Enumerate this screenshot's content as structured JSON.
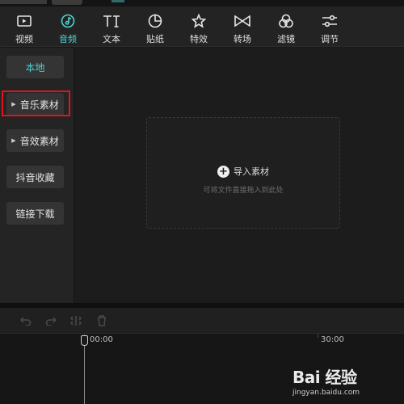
{
  "toolbar": {
    "items": [
      {
        "label": "视频",
        "icon": "video-icon"
      },
      {
        "label": "音频",
        "icon": "music-note-icon"
      },
      {
        "label": "文本",
        "icon": "text-icon"
      },
      {
        "label": "贴纸",
        "icon": "sticker-icon"
      },
      {
        "label": "特效",
        "icon": "effects-star-icon"
      },
      {
        "label": "转场",
        "icon": "transition-icon"
      },
      {
        "label": "滤镜",
        "icon": "filter-icon"
      },
      {
        "label": "调节",
        "icon": "adjust-sliders-icon"
      }
    ],
    "active": "音频"
  },
  "sidebar": {
    "items": [
      {
        "label": "本地"
      },
      {
        "label": "音乐素材"
      },
      {
        "label": "音效素材"
      },
      {
        "label": "抖音收藏"
      },
      {
        "label": "链接下载"
      }
    ]
  },
  "main": {
    "import_label": "导入素材",
    "drop_hint": "可将文件直接拖入到此处"
  },
  "timeline": {
    "time_start": "00:00",
    "time_30": "30:00"
  },
  "watermark": {
    "logo": "Bai  经验",
    "url": "jingyan.baidu.com"
  },
  "colors": {
    "accent": "#4fd2d2",
    "highlight": "#e0141c",
    "background": "#1c1c1c"
  }
}
